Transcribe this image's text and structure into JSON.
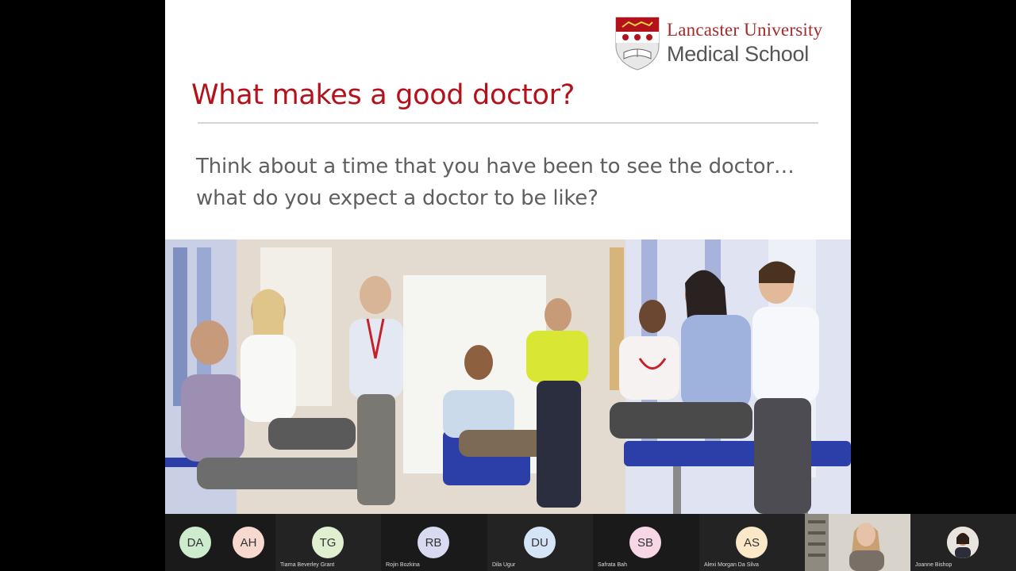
{
  "slide": {
    "logo": {
      "line1": "Lancaster University",
      "line2": "Medical School"
    },
    "title": "What makes a good doctor?",
    "body_line1": "Think about a time that you have been to see the doctor…",
    "body_line2": "what do you expect a doctor to be like?"
  },
  "participants": [
    {
      "initials": "DA",
      "name": "",
      "color": "#cdeccd"
    },
    {
      "initials": "AH",
      "name": "",
      "color": "#f7d9cf"
    },
    {
      "initials": "TG",
      "name": "Tiarna Beverley Grant",
      "color": "#dff0d0"
    },
    {
      "initials": "RB",
      "name": "Rojin Bozkina",
      "color": "#d9d9f2"
    },
    {
      "initials": "DU",
      "name": "Dila Ugur",
      "color": "#d5e4f6"
    },
    {
      "initials": "SB",
      "name": "Safrata Bah",
      "color": "#f7d7e6"
    },
    {
      "initials": "AS",
      "name": "Alexi Morgan Da Silva",
      "color": "#fae8c8"
    }
  ],
  "video_participant": {
    "name": ""
  },
  "last_participant": {
    "name": "Joanne Bishop"
  },
  "colors": {
    "title_red": "#b3121b",
    "logo_red": "#a52a2a",
    "body_gray": "#5f5f5f"
  }
}
